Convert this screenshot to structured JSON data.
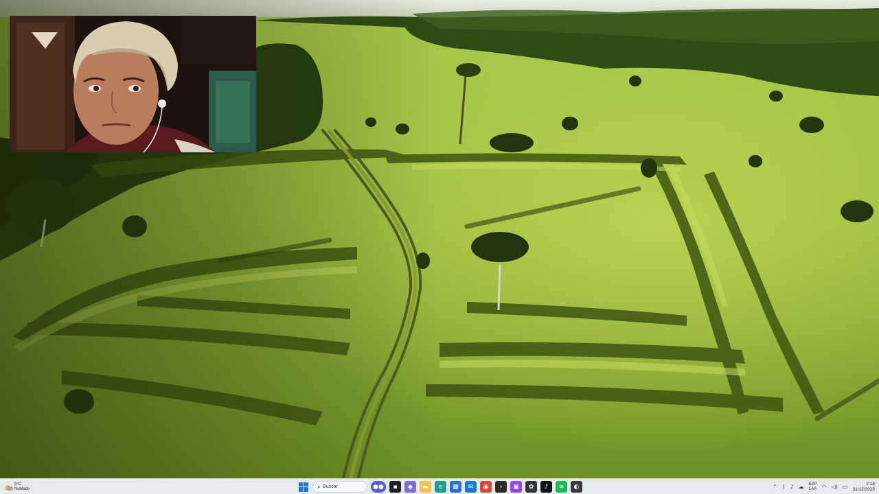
{
  "taskbar": {
    "weather": {
      "temp": "9°C",
      "condition": "Nublado"
    },
    "search_placeholder": "Buscar",
    "apps": [
      {
        "name": "copilot-app",
        "color": "#7b6ce0",
        "glyph": "◆"
      },
      {
        "name": "file-explorer",
        "color": "#f2c14e",
        "glyph": "▬"
      },
      {
        "name": "edge-browser",
        "color": "#1f9e8f",
        "glyph": "e"
      },
      {
        "name": "store",
        "color": "#2b6fd1",
        "glyph": "▦"
      },
      {
        "name": "mail",
        "color": "#1a78d6",
        "glyph": "✉"
      },
      {
        "name": "chrome",
        "color": "#db4437",
        "glyph": "◉"
      },
      {
        "name": "terminal",
        "color": "#2b2b2b",
        "glyph": "›"
      },
      {
        "name": "twitch",
        "color": "#9146ff",
        "glyph": "▣"
      },
      {
        "name": "davinci",
        "color": "#30363d",
        "glyph": "✿"
      },
      {
        "name": "tiktok",
        "color": "#111111",
        "glyph": "♪"
      },
      {
        "name": "spotify",
        "color": "#1db954",
        "glyph": "≋"
      },
      {
        "name": "obs",
        "color": "#3a3a3a",
        "glyph": "◐"
      }
    ],
    "tray": {
      "lang_top": "ESP",
      "lang_bottom": "LAA",
      "time": "2:18",
      "date": "31/12/2025"
    }
  }
}
